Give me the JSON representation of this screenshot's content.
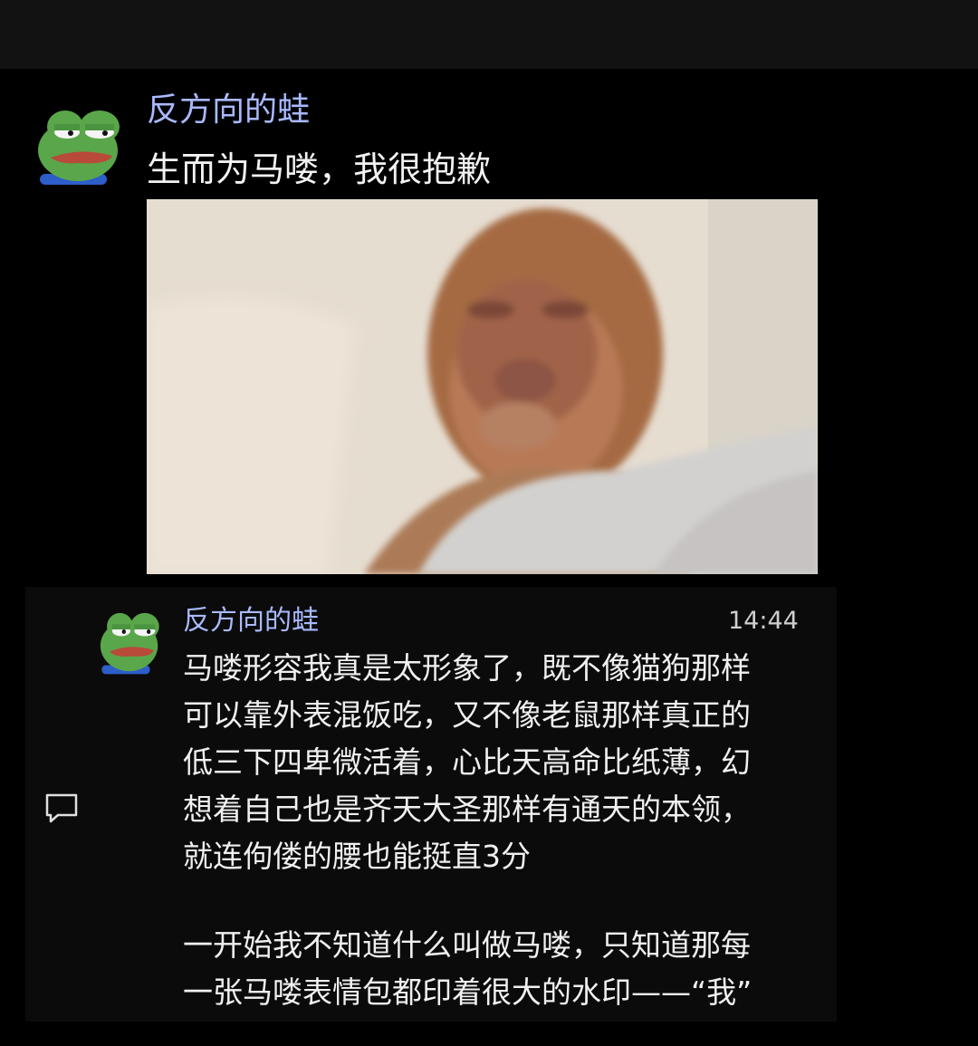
{
  "post": {
    "author": "反方向的蛙",
    "text": "生而为马喽，我很抱歉",
    "avatar_icon": "pepe-frog-avatar",
    "image_icon": "sleeping-monkey-photo"
  },
  "comment": {
    "author": "反方向的蛙",
    "time": "14:44",
    "avatar_icon": "pepe-frog-avatar",
    "reply_icon": "comment-bubble-icon",
    "lines": [
      "马喽形容我真是太形象了，既不像猫狗那样",
      "可以靠外表混饭吃，又不像老鼠那样真正的",
      "低三下四卑微活着，心比天高命比纸薄，幻",
      "想着自己也是齐天大圣那样有通天的本领，",
      "就连佝偻的腰也能挺直3分",
      "一开始我不知道什么叫做马喽，只知道那每",
      "一张马喽表情包都印着很大的水印——“我”"
    ]
  },
  "colors": {
    "background": "#000000",
    "username": "#a9b9ff",
    "text": "#f2f2f2",
    "card": "#0b0b0b"
  }
}
